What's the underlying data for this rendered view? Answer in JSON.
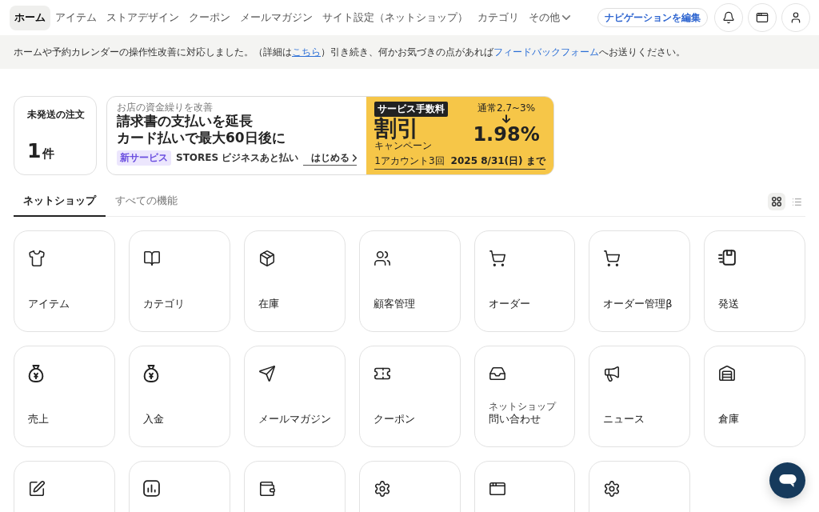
{
  "nav": {
    "items": [
      {
        "label": "ホーム",
        "kind": "link",
        "selected": true
      },
      {
        "label": "アイテム",
        "kind": "link",
        "selected": false
      },
      {
        "label": "ストアデザイン",
        "kind": "link",
        "selected": false
      },
      {
        "label": "クーポン",
        "kind": "link",
        "selected": false
      },
      {
        "label": "メールマガジン",
        "kind": "link",
        "selected": false
      },
      {
        "label": "サイト設定（ネットショップ）",
        "kind": "link",
        "selected": false
      },
      {
        "label": "カテゴリ",
        "kind": "link",
        "selected": false
      },
      {
        "label": "その他",
        "kind": "dropdown",
        "selected": false
      }
    ],
    "edit_button": "ナビゲーションを編集"
  },
  "notice": {
    "parts": [
      {
        "kind": "text",
        "text": "ホームや予約カレンダーの操作性改善に対応しました。（詳細は",
        "underlined": false
      },
      {
        "kind": "link",
        "text": "こちら",
        "underlined": true
      },
      {
        "kind": "text",
        "text": "）引き続き、何かお気づきの点があれば",
        "underlined": false
      },
      {
        "kind": "link",
        "text": "フィードバックフォーム",
        "underlined": false
      },
      {
        "kind": "text",
        "text": "へお送りください。",
        "underlined": false
      }
    ]
  },
  "unshipped_orders": {
    "label": "未発送の注文",
    "count": "1",
    "unit": "件"
  },
  "promo_banner": {
    "eyebrow": "お店の資金繰りを改善",
    "headline": [
      "請求書の支払いを延長",
      "カード払いで最大60日後に"
    ],
    "tag": "新サービス",
    "product": "STORES ビジネスあと払い",
    "cta": "はじめる",
    "fee_tag": "サービス手数料",
    "discount": "割引",
    "campaign": "キャンペーン",
    "regular_rate": "通常2.7~3%",
    "rate": "1.98%",
    "terms": "1アカウント3回",
    "period": "2025 8/31(日) まで"
  },
  "tabs": [
    {
      "label": "ネットショップ",
      "selected": true
    },
    {
      "label": "すべての機能",
      "selected": false
    }
  ],
  "view_toggle": [
    {
      "kind": "grid",
      "selected": true
    },
    {
      "kind": "list",
      "selected": false
    }
  ],
  "tiles": [
    {
      "kind": "labeled",
      "label": "アイテム"
    },
    {
      "kind": "labeled",
      "label": "カテゴリ"
    },
    {
      "kind": "labeled",
      "label": "在庫"
    },
    {
      "kind": "labeled",
      "label": "顧客管理"
    },
    {
      "kind": "labeled",
      "label": "オーダー"
    },
    {
      "kind": "labeled",
      "label": "オーダー管理β"
    },
    {
      "kind": "labeled",
      "label": "発送"
    },
    {
      "kind": "labeled",
      "label": "売上"
    },
    {
      "kind": "labeled",
      "label": "入金"
    },
    {
      "kind": "labeled",
      "label": "メールマガジン"
    },
    {
      "kind": "labeled",
      "label": "クーポン"
    },
    {
      "kind": "labeled",
      "label": "問い合わせ",
      "caption": "ネットショップ"
    },
    {
      "kind": "labeled",
      "label": "ニュース"
    },
    {
      "kind": "labeled",
      "label": "倉庫"
    },
    {
      "kind": "clipped"
    },
    {
      "kind": "clipped"
    },
    {
      "kind": "clipped"
    },
    {
      "kind": "clipped"
    },
    {
      "kind": "clipped"
    },
    {
      "kind": "clipped"
    }
  ]
}
